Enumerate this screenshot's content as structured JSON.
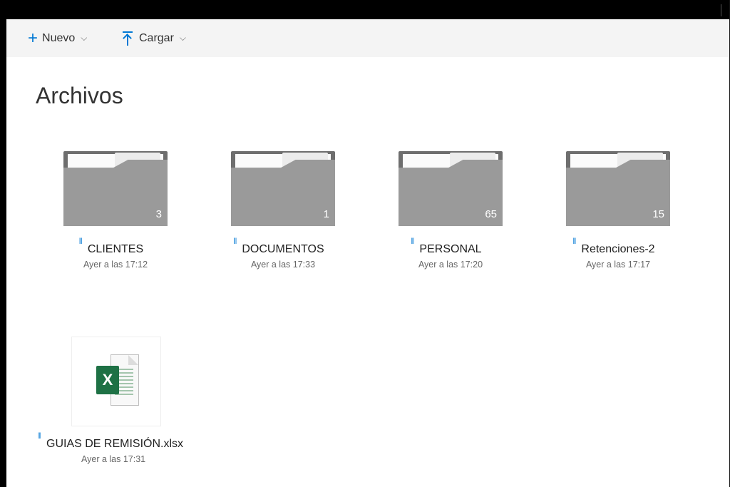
{
  "commandbar": {
    "new_label": "Nuevo",
    "upload_label": "Cargar"
  },
  "page": {
    "title": "Archivos"
  },
  "folders": [
    {
      "name": "CLIENTES",
      "modified": "Ayer a las 17:12",
      "count": "3"
    },
    {
      "name": "DOCUMENTOS",
      "modified": "Ayer a las 17:33",
      "count": "1"
    },
    {
      "name": "PERSONAL",
      "modified": "Ayer a las 17:20",
      "count": "65"
    },
    {
      "name": "Retenciones-2",
      "modified": "Ayer a las 17:17",
      "count": "15"
    }
  ],
  "files": [
    {
      "name": "GUIAS DE REMISIÓN.xlsx",
      "modified": "Ayer a las 17:31",
      "icon": "excel-icon",
      "badge": "X"
    }
  ],
  "colors": {
    "accent": "#0078d4",
    "excel": "#1e7145",
    "folder": "#9a9a9a"
  }
}
